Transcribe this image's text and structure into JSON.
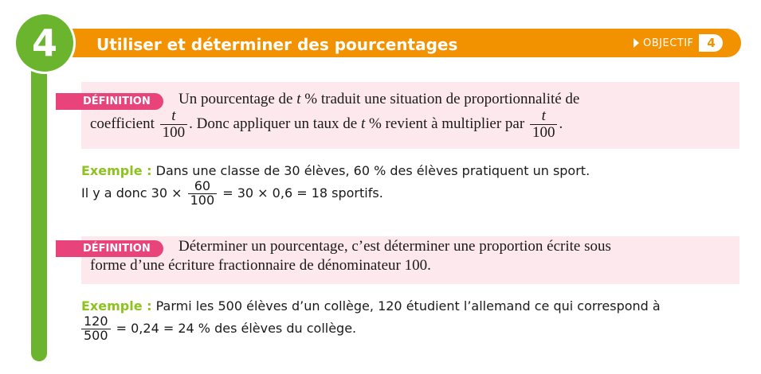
{
  "header": {
    "number": "4",
    "title": "Utiliser et déterminer des pourcentages",
    "objectif_label": "OBJECTIF",
    "objectif_num": "4"
  },
  "definition1": {
    "tag": "DÉFINITION",
    "line1_a": "Un pourcentage de ",
    "line1_var": "t",
    "line1_b": " % traduit une situation de proportionnalité de",
    "line2_a": "coefficient ",
    "frac1_num": "t",
    "frac1_den": "100",
    "line2_b": ". Donc appliquer un taux de ",
    "line2_var": "t",
    "line2_c": " % revient à multiplier par ",
    "frac2_num": "t",
    "frac2_den": "100",
    "line2_d": "."
  },
  "example1": {
    "label": "Exemple :",
    "line1": " Dans une classe de 30 élèves, 60 % des élèves pratiquent un sport.",
    "line2_a": "Il y a donc 30 × ",
    "frac_num": "60",
    "frac_den": "100",
    "line2_b": " = 30 × 0,6 = 18 sportifs."
  },
  "definition2": {
    "tag": "DÉFINITION",
    "line1": "Déterminer un pourcentage, c’est déterminer une proportion écrite sous",
    "line2": "forme d’une écriture fractionnaire de dénominateur 100."
  },
  "example2": {
    "label": "Exemple :",
    "line1": " Parmi les 500 élèves d’un collège, 120 étudient l’allemand ce qui correspond à",
    "frac_num": "120",
    "frac_den": "500",
    "line2_b": " = 0,24 = 24 % des élèves du collège."
  }
}
